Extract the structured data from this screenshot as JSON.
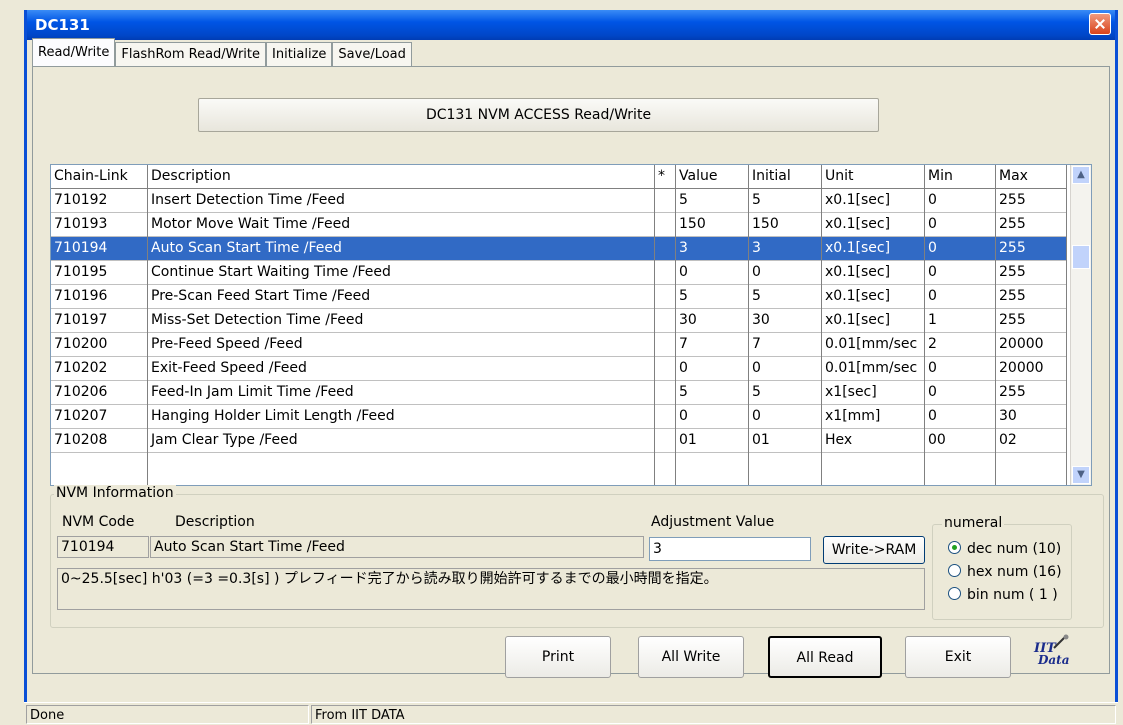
{
  "window": {
    "title": "DC131"
  },
  "tabs": [
    "Read/Write",
    "FlashRom Read/Write",
    "Initialize",
    "Save/Load"
  ],
  "header_button": "DC131 NVM ACCESS Read/Write",
  "grid": {
    "columns": [
      "Chain-Link",
      "Description",
      "*",
      "Value",
      "Initial",
      "Unit",
      "Min",
      "Max"
    ],
    "rows": [
      [
        "710192",
        "Insert Detection Time /Feed",
        "",
        "5",
        "5",
        "x0.1[sec]",
        "0",
        "255"
      ],
      [
        "710193",
        "Motor Move Wait Time /Feed",
        "",
        "150",
        "150",
        "x0.1[sec]",
        "0",
        "255"
      ],
      [
        "710194",
        "Auto Scan Start Time /Feed",
        "",
        "3",
        "3",
        "x0.1[sec]",
        "0",
        "255"
      ],
      [
        "710195",
        "Continue Start Waiting Time /Feed",
        "",
        "0",
        "0",
        "x0.1[sec]",
        "0",
        "255"
      ],
      [
        "710196",
        "Pre-Scan Feed Start Time /Feed",
        "",
        "5",
        "5",
        "x0.1[sec]",
        "0",
        "255"
      ],
      [
        "710197",
        "Miss-Set Detection Time /Feed",
        "",
        "30",
        "30",
        "x0.1[sec]",
        "1",
        "255"
      ],
      [
        "710200",
        "Pre-Feed Speed /Feed",
        "",
        "7",
        "7",
        "0.01[mm/sec",
        "2",
        "20000"
      ],
      [
        "710202",
        "Exit-Feed Speed /Feed",
        "",
        "0",
        "0",
        "0.01[mm/sec",
        "0",
        "20000"
      ],
      [
        "710206",
        "Feed-In Jam Limit Time /Feed",
        "",
        "5",
        "5",
        "x1[sec]",
        "0",
        "255"
      ],
      [
        "710207",
        "Hanging Holder Limit Length /Feed",
        "",
        "0",
        "0",
        "x1[mm]",
        "0",
        "30"
      ],
      [
        "710208",
        "Jam Clear Type /Feed",
        "",
        "01",
        "01",
        "Hex",
        "00",
        "02"
      ]
    ],
    "selected_index": 2
  },
  "nvm_info": {
    "group_label": "NVM Information",
    "code_label": "NVM Code",
    "desc_label": "Description",
    "adj_label": "Adjustment Value",
    "code": "710194",
    "description": "Auto Scan Start Time /Feed",
    "adjustment_value": "3",
    "write_button": "Write->RAM",
    "detail": "0~25.5[sec]  h'03 (=3 =0.3[s] ) プレフィード完了から読み取り開始許可するまでの最小時間を指定。"
  },
  "numeral": {
    "label": "numeral",
    "options": [
      "dec num (10)",
      "hex num (16)",
      "bin num  ( 1 )"
    ],
    "selected": 0
  },
  "buttons": {
    "print": "Print",
    "all_write": "All Write",
    "all_read": "All Read",
    "exit": "Exit"
  },
  "status": {
    "left": "Done",
    "right": "From IIT DATA"
  },
  "logo_text": "IIT Data",
  "colors": {
    "selection": "#316AC5",
    "titlebar": "#0055E5"
  }
}
